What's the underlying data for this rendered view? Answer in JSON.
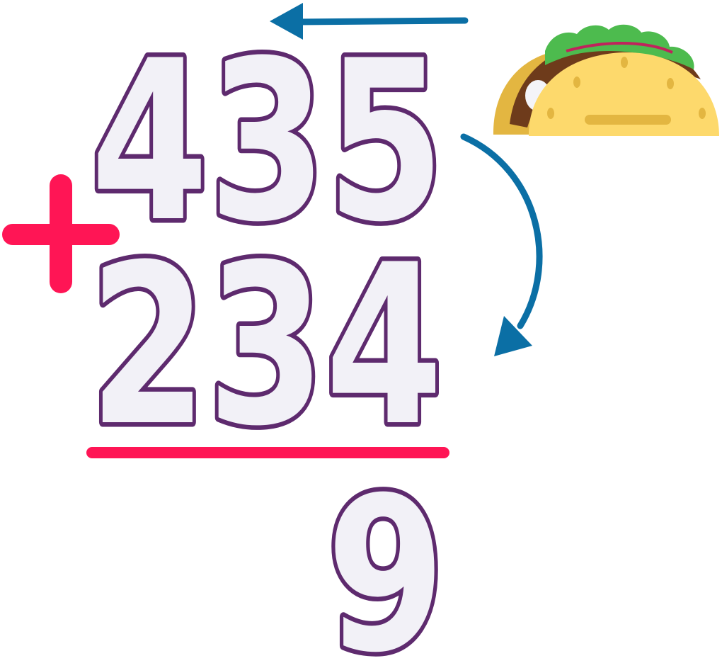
{
  "problem": {
    "addend_top": "435",
    "addend_bottom": "234",
    "operator": "plus",
    "partial_sum": "9"
  },
  "icons": {
    "taco": "taco-icon",
    "carry_arrow": "curved-arrow-down-icon",
    "direction_arrow": "arrow-left-icon"
  },
  "colors": {
    "digit_fill": "#f2f1f7",
    "digit_outline": "#5e2a6e",
    "operator": "#ff1555",
    "arrow": "#0b6fa5",
    "taco_shell": "#fdd96c",
    "taco_shell_dark": "#e3b641",
    "lettuce": "#4dbb4e",
    "meat": "#6e3b1b"
  }
}
